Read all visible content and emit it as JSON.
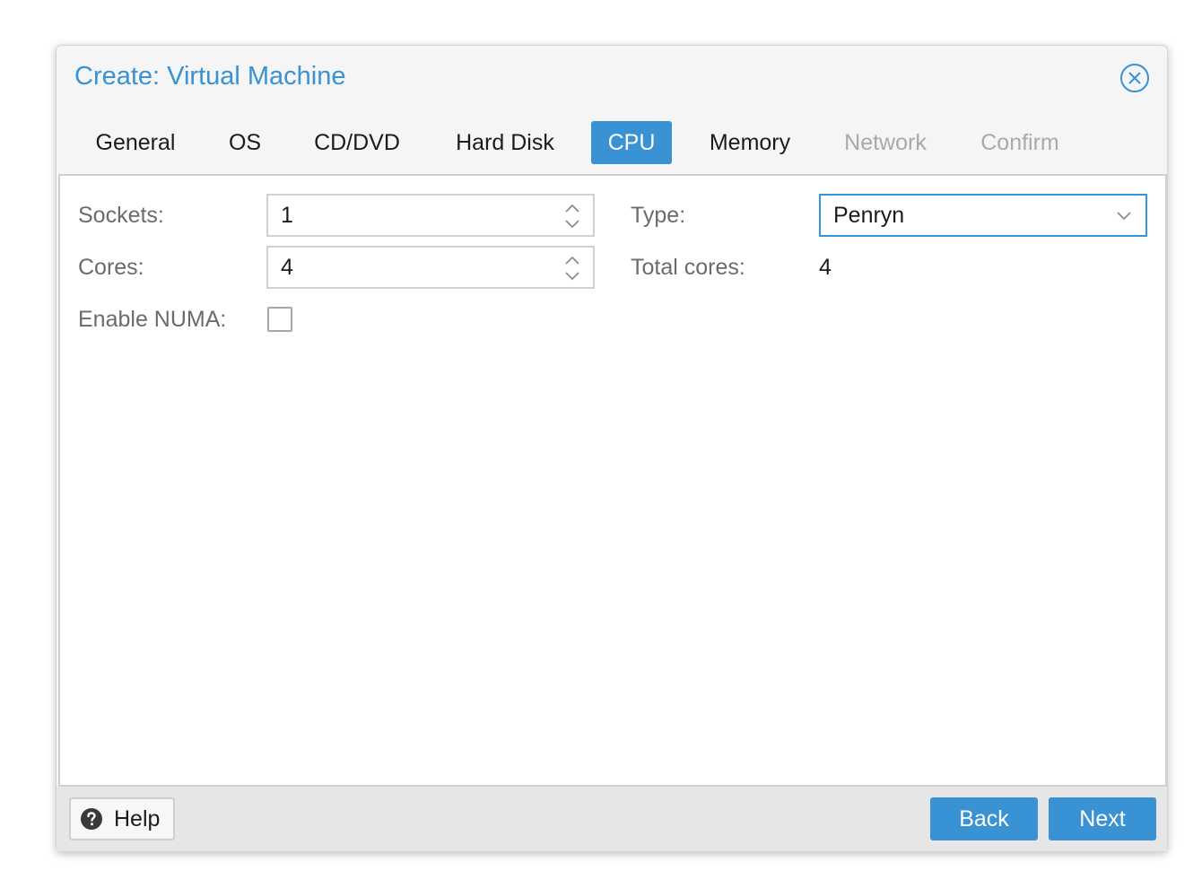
{
  "dialog": {
    "title": "Create: Virtual Machine",
    "close_icon": "close-circle-icon"
  },
  "tabs": [
    {
      "label": "General",
      "state": "normal"
    },
    {
      "label": "OS",
      "state": "normal"
    },
    {
      "label": "CD/DVD",
      "state": "normal"
    },
    {
      "label": "Hard Disk",
      "state": "normal"
    },
    {
      "label": "CPU",
      "state": "active"
    },
    {
      "label": "Memory",
      "state": "normal"
    },
    {
      "label": "Network",
      "state": "disabled"
    },
    {
      "label": "Confirm",
      "state": "disabled"
    }
  ],
  "form": {
    "sockets": {
      "label": "Sockets:",
      "value": "1"
    },
    "cores": {
      "label": "Cores:",
      "value": "4"
    },
    "numa": {
      "label": "Enable NUMA:",
      "checked": false
    },
    "type": {
      "label": "Type:",
      "value": "Penryn"
    },
    "total_cores": {
      "label": "Total cores:",
      "value": "4"
    }
  },
  "footer": {
    "help_label": "Help",
    "back_label": "Back",
    "next_label": "Next"
  },
  "colors": {
    "accent": "#3892d4",
    "disabled_text": "#a9a9a9",
    "label_text": "#6b6b6b"
  }
}
